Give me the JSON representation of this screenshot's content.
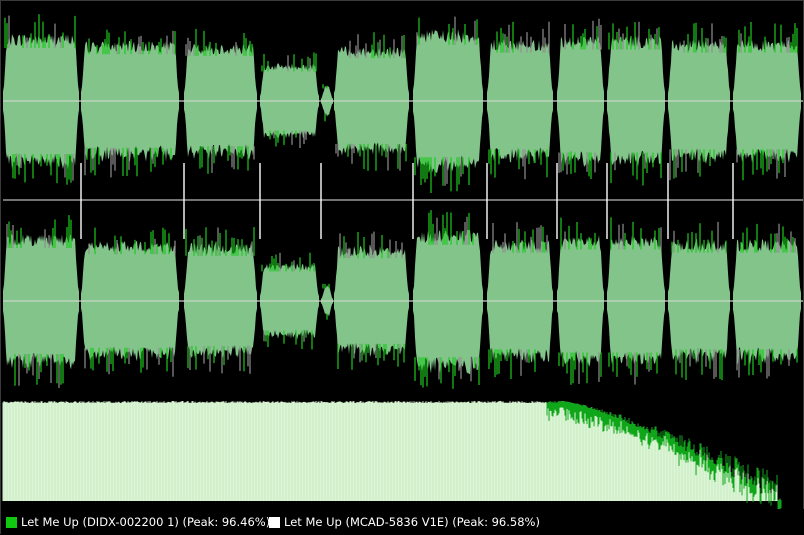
{
  "colors": {
    "background": "#000000",
    "overlay_green": "#1fc91f",
    "overlay_grey": "#8f8f8f",
    "fill_green": "#82c48a",
    "spectrum_light": "#dbf5d6",
    "spectrum_dark": "#10a61a",
    "track_marker": "#ffffff",
    "center_line": "#c8d6c8"
  },
  "legend": {
    "items": [
      {
        "label": "Let Me Up (DIDX-002200 1) (Peak: 96.46%)",
        "color": "#10c810"
      },
      {
        "label": "Let Me Up (MCAD-5836 V1E) (Peak: 96.58%)",
        "color": "#ffffff"
      }
    ]
  }
}
